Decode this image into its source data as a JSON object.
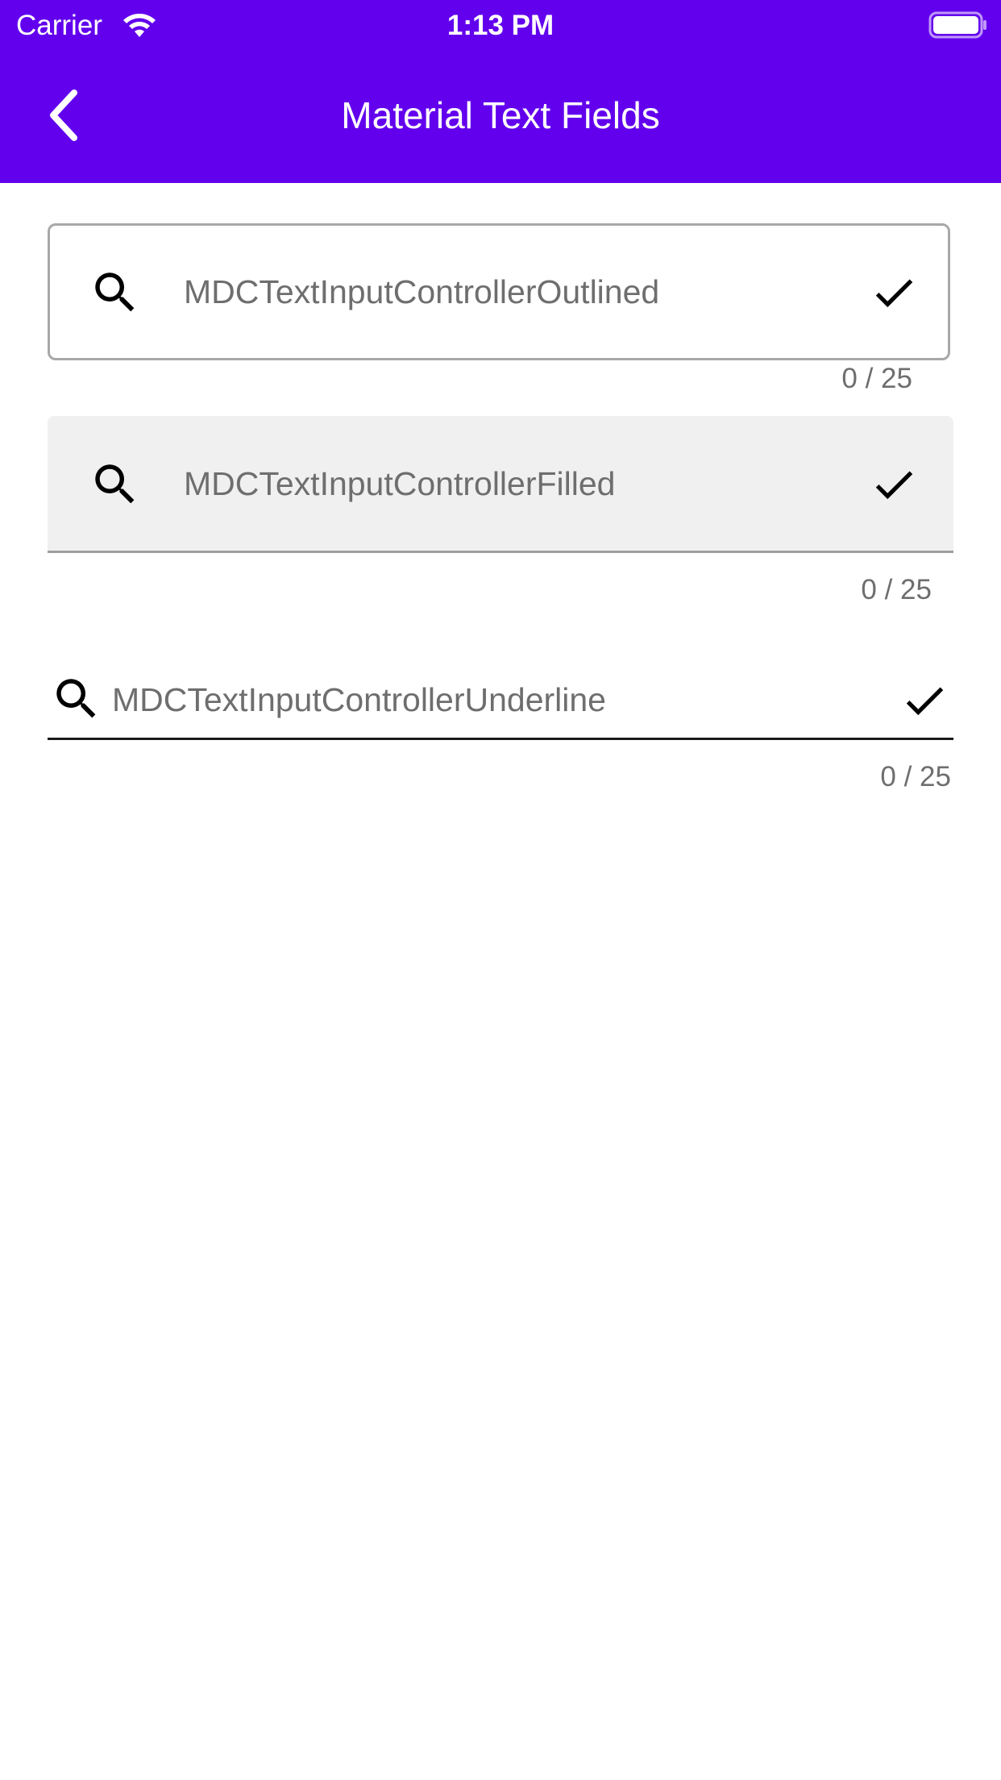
{
  "status_bar": {
    "carrier": "Carrier",
    "time": "1:13 PM"
  },
  "app_bar": {
    "title": "Material Text Fields",
    "color": "#6200ee"
  },
  "fields": {
    "outlined": {
      "placeholder": "MDCTextInputControllerOutlined",
      "counter": "0 / 25",
      "leading_icon": "search-icon",
      "trailing_icon": "checkmark-icon"
    },
    "filled": {
      "placeholder": "MDCTextInputControllerFilled",
      "counter": "0 / 25",
      "leading_icon": "search-icon",
      "trailing_icon": "checkmark-icon"
    },
    "underline": {
      "placeholder": "MDCTextInputControllerUnderline",
      "counter": "0 / 25",
      "leading_icon": "search-icon",
      "trailing_icon": "checkmark-icon"
    }
  }
}
